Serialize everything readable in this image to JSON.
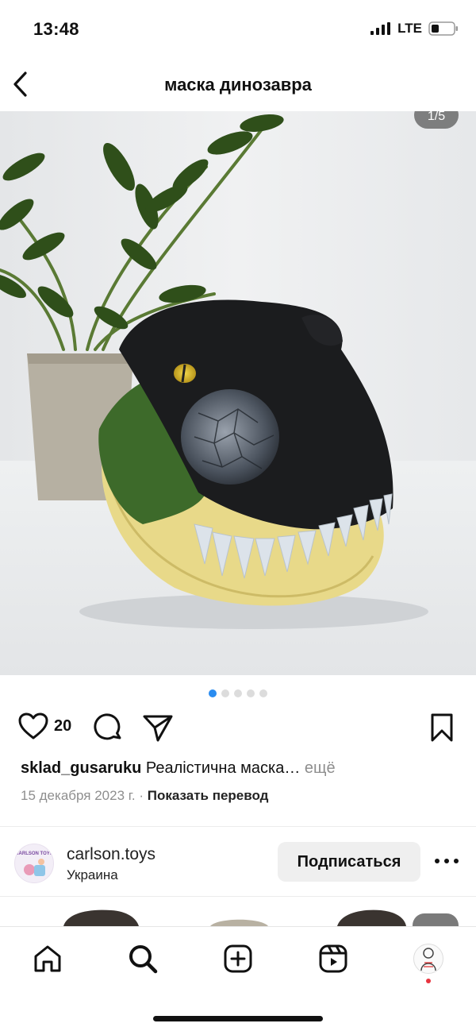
{
  "status": {
    "time": "13:48",
    "network": "LTE"
  },
  "header": {
    "title": "маска динозавра"
  },
  "post": {
    "photo_counter": "1/5",
    "carousel": {
      "total": 5,
      "active": 1
    },
    "likes": "20",
    "username": "sklad_gusaruku",
    "caption": "Реалістична маска…",
    "more_label": "ещё",
    "date": "15 декабря 2023 г.",
    "separator": "·",
    "translate_label": "Показать перевод"
  },
  "suggested_profile": {
    "avatar_text": "CARLSON TOYS",
    "name": "carlson.toys",
    "location": "Украина",
    "subscribe_label": "Подписаться"
  },
  "tabbar": {
    "items": [
      "home-icon",
      "search-icon",
      "create-icon",
      "reels-icon",
      "profile-avatar"
    ]
  },
  "colors": {
    "accent": "#2a8cf0",
    "notification": "#e8343e"
  }
}
